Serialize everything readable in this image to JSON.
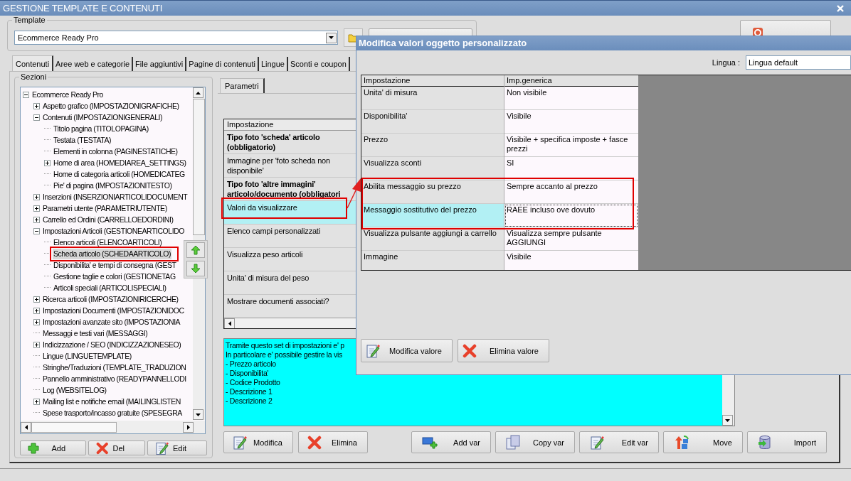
{
  "window": {
    "title": "GESTIONE TEMPLATE E CONTENUTI"
  },
  "template": {
    "legend": "Template",
    "value": "Ecommerce Ready Pro"
  },
  "tabs": [
    {
      "label": "Contenuti",
      "selected": true
    },
    {
      "label": "Aree web e categorie",
      "selected": false
    },
    {
      "label": "File aggiuntivi",
      "selected": false
    },
    {
      "label": "Pagine di contenuti",
      "selected": false
    },
    {
      "label": "Lingue",
      "selected": false
    },
    {
      "label": "Sconti e coupon",
      "selected": false
    }
  ],
  "sections": {
    "legend": "Sezioni",
    "tree": [
      {
        "label": "Ecommerce Ready Pro",
        "selected": false,
        "expanded": true,
        "children": [
          {
            "label": "Aspetto grafico (IMPOSTAZIONIGRAFICHE)",
            "selected": false,
            "expanded": false
          },
          {
            "label": "Contenuti (IMPOSTAZIONIGENERALI)",
            "selected": false,
            "expanded": true,
            "children": [
              {
                "label": "Titolo pagina (TITOLOPAGINA)",
                "selected": false
              },
              {
                "label": "Testata (TESTATA)",
                "selected": false
              },
              {
                "label": "Elementi in colonna (PAGINESTATICHE)",
                "selected": false
              },
              {
                "label": "Home di area (HOMEDIAREA_SETTINGS)",
                "selected": false,
                "expanded": false
              },
              {
                "label": "Home di categoria articoli (HOMEDICATEG",
                "selected": false
              },
              {
                "label": "Pie' di pagina (IMPOSTAZIONITESTO)",
                "selected": false
              }
            ]
          },
          {
            "label": "Inserzioni (INSERZIONIARTICOLIDOCUMENT",
            "selected": false,
            "expanded": false
          },
          {
            "label": "Parametri utente (PARAMETRIUTENTE)",
            "selected": false,
            "expanded": false
          },
          {
            "label": "Carrello ed Ordini (CARRELLOEDORDINI)",
            "selected": false,
            "expanded": false
          },
          {
            "label": "Impostazioni Articoli (GESTIONEARTICOLIDO",
            "selected": false,
            "expanded": true,
            "children": [
              {
                "label": "Elenco articoli (ELENCOARTICOLI)",
                "selected": false
              },
              {
                "label": "Scheda articolo (SCHEDAARTICOLO)",
                "selected": true
              },
              {
                "label": "Disponibilita' e tempi di consegna (GEST",
                "selected": false
              },
              {
                "label": "Gestione taglie e colori (GESTIONETAG",
                "selected": false
              },
              {
                "label": "Articoli speciali (ARTICOLISPECIALI)",
                "selected": false
              }
            ]
          },
          {
            "label": "Ricerca articoli (IMPOSTAZIONIRICERCHE)",
            "selected": false,
            "expanded": false
          },
          {
            "label": "Impostazioni Documenti (IMPOSTAZIONIDOC",
            "selected": false,
            "expanded": false
          },
          {
            "label": "Impostazioni avanzate sito (IMPOSTAZIONIA",
            "selected": false,
            "expanded": false
          },
          {
            "label": "Messaggi e testi vari (MESSAGGI)",
            "selected": false
          },
          {
            "label": "Indicizzazione / SEO (INDICIZZAZIONESEO)",
            "selected": false,
            "expanded": false
          },
          {
            "label": "Lingue (LINGUETEMPLATE)",
            "selected": false
          },
          {
            "label": "Stringhe/Traduzioni (TEMPLATE_TRADUZION",
            "selected": false
          },
          {
            "label": "Pannello amministrativo (READYPANNELLODI",
            "selected": false
          },
          {
            "label": "Log (WEBSITELOG)",
            "selected": false
          },
          {
            "label": "Mailing list e notifiche email (MAILINGLISTEN",
            "selected": false,
            "expanded": false
          },
          {
            "label": "Spese trasporto/incasso gratuite (SPESEGRA",
            "selected": false
          }
        ]
      }
    ],
    "buttons": [
      {
        "label": "Add",
        "kind": "add"
      },
      {
        "label": "Del",
        "kind": "delete"
      },
      {
        "label": "Edit",
        "kind": "edit"
      }
    ]
  },
  "parameters": {
    "tab": "Parametri",
    "column": "Impostazione",
    "rows": [
      {
        "label": "Tipo foto 'scheda' articolo (obbligatorio)",
        "emphasized": true,
        "selected": false
      },
      {
        "label": "Immagine per 'foto scheda non disponibile'",
        "emphasized": false,
        "selected": false
      },
      {
        "label": "Tipo foto 'altre immagini' articolo/documento (obbligatori",
        "emphasized": true,
        "selected": false
      },
      {
        "label": "Valori da visualizzare",
        "emphasized": false,
        "selected": true
      },
      {
        "label": "Elenco campi personalizzati",
        "emphasized": false,
        "selected": false
      },
      {
        "label": "Visualizza peso articoli",
        "emphasized": false,
        "selected": false
      },
      {
        "label": "Unita' di misura del peso",
        "emphasized": false,
        "selected": false
      },
      {
        "label": "Mostrare documenti associati?",
        "emphasized": false,
        "selected": false
      }
    ],
    "description": [
      "Tramite questo set di impostazioni e' p",
      "In particolare e' possibile gestire la vis",
      "- Prezzo articolo",
      "- Disponibilita'",
      "- Codice Prodotto",
      "- Descrizione 1",
      "- Descrizione 2"
    ],
    "buttons": [
      {
        "label": "Modifica",
        "kind": "edit"
      },
      {
        "label": "Elimina",
        "kind": "delete"
      }
    ],
    "var_buttons": [
      {
        "label": "Add var",
        "kind": "add-var"
      },
      {
        "label": "Copy var",
        "kind": "copy"
      },
      {
        "label": "Edit var",
        "kind": "edit"
      },
      {
        "label": "Move",
        "kind": "move"
      },
      {
        "label": "Import",
        "kind": "import"
      }
    ]
  },
  "dialog": {
    "title": "Modifica valori oggetto personalizzato",
    "language_label": "Lingua :",
    "language": "Lingua default",
    "columns": [
      "Impostazione",
      "Imp.generica"
    ],
    "rows": [
      {
        "setting": "Unita' di misura",
        "value": "Non visibile",
        "selected": false
      },
      {
        "setting": "Disponibilita'",
        "value": "Visibile",
        "selected": false
      },
      {
        "setting": "Prezzo",
        "value": "Visibile + specifica imposte + fasce prezzi",
        "selected": false
      },
      {
        "setting": "Visualizza sconti",
        "value": "SI",
        "selected": false
      },
      {
        "setting": "Abilita messaggio su prezzo",
        "value": "Sempre accanto al prezzo",
        "selected": false
      },
      {
        "setting": "Messaggio sostitutivo del prezzo",
        "value": "RAEE incluso ove dovuto",
        "selected": true
      },
      {
        "setting": "Visualizza pulsante aggiungi a carrello",
        "value": "Visualizza sempre pulsante AGGIUNGI",
        "selected": false
      },
      {
        "setting": "Immagine",
        "value": "Visibile",
        "selected": false
      }
    ],
    "buttons": [
      {
        "label": "Modifica valore",
        "kind": "edit"
      },
      {
        "label": "Elimina valore",
        "kind": "delete"
      }
    ]
  }
}
